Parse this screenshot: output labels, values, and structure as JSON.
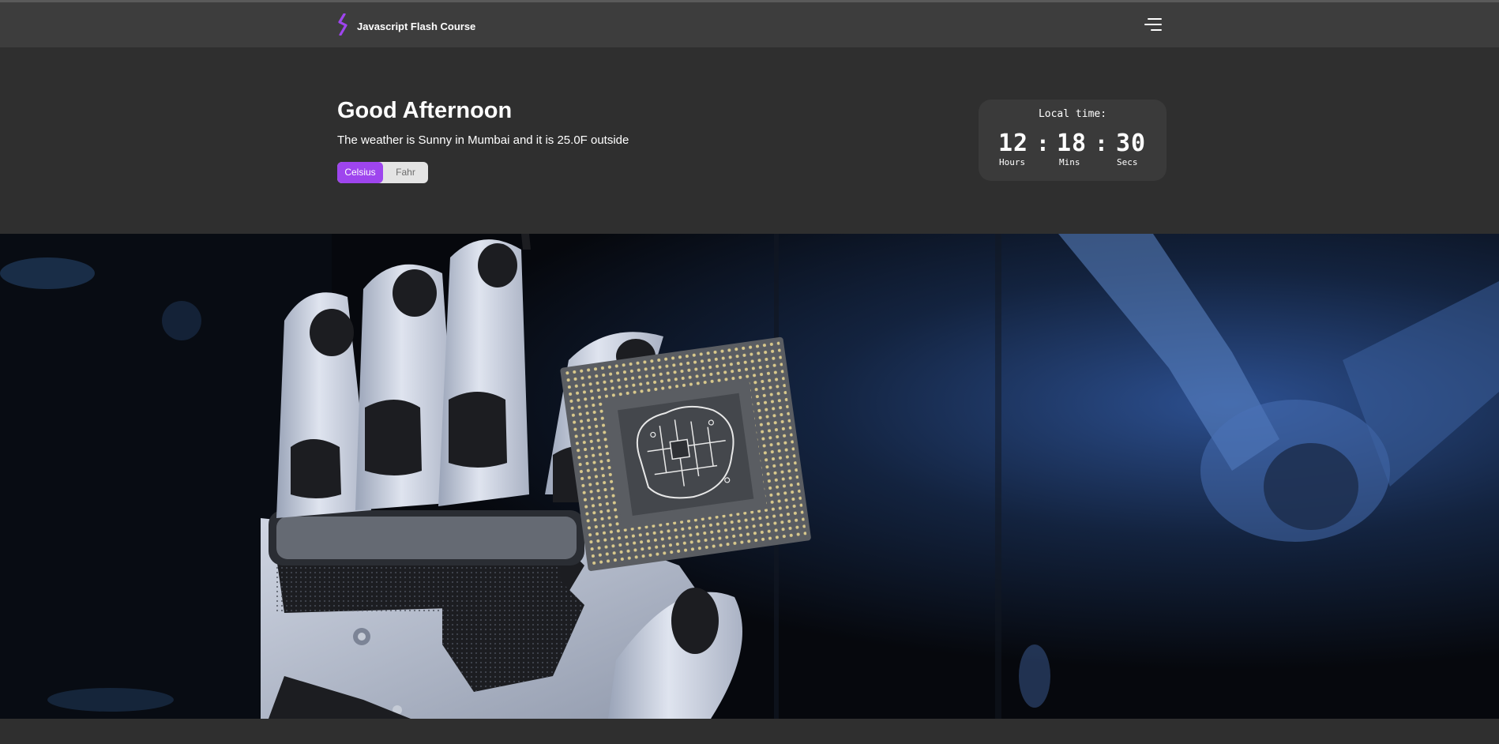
{
  "nav": {
    "brand": "Javascript Flash Course",
    "logo_icon": "lightning-bolt-icon",
    "menu_icon": "hamburger-menu-icon"
  },
  "hero": {
    "greeting": "Good Afternoon",
    "weather_text": "The weather is Sunny in Mumbai and it is 25.0F outside",
    "toggle": {
      "celsius_label": "Celsius",
      "fahr_label": "Fahr",
      "selected": "Celsius"
    }
  },
  "clock": {
    "title": "Local time:",
    "hours": "12",
    "mins": "18",
    "secs": "30",
    "separator": ":",
    "hours_label": "Hours",
    "mins_label": "Mins",
    "secs_label": "Secs"
  },
  "colors": {
    "accent": "#9e45ee",
    "background": "#2f2f2f",
    "navbar": "#3d3d3d",
    "clock_card": "#3a3a3a"
  }
}
